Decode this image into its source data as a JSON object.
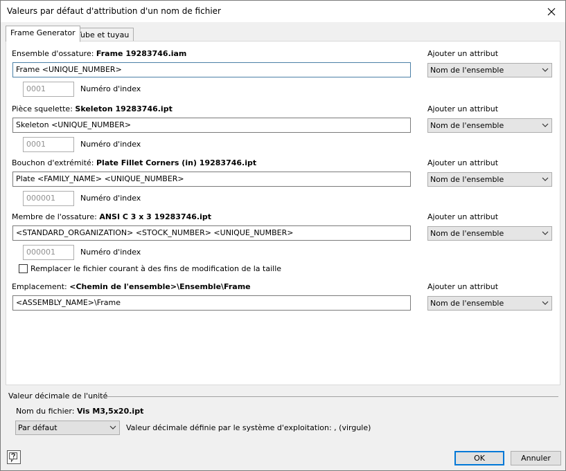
{
  "window": {
    "title": "Valeurs par défaut d'attribution d'un nom de fichier"
  },
  "tabs": [
    {
      "label": "Frame Generator"
    },
    {
      "label": "Tube et tuyau"
    }
  ],
  "sections": [
    {
      "label": "Ensemble d'ossature:",
      "name": "Frame 19283746.iam",
      "value": "Frame <UNIQUE_NUMBER>",
      "index_value": "0001",
      "index_label": "Numéro d'index",
      "attr_label": "Ajouter un attribut",
      "attr_value": "Nom de l'ensemble"
    },
    {
      "label": "Pièce squelette:",
      "name": "Skeleton 19283746.ipt",
      "value": "Skeleton <UNIQUE_NUMBER>",
      "index_value": "0001",
      "index_label": "Numéro d'index",
      "attr_label": "Ajouter un attribut",
      "attr_value": "Nom de l'ensemble"
    },
    {
      "label": "Bouchon d'extrémité:",
      "name": "Plate Fillet Corners (in) 19283746.ipt",
      "value": "Plate <FAMILY_NAME> <UNIQUE_NUMBER>",
      "index_value": "000001",
      "index_label": "Numéro d'index",
      "attr_label": "Ajouter un attribut",
      "attr_value": "Nom de l'ensemble"
    },
    {
      "label": "Membre de l'ossature:",
      "name": "ANSI C 3 x 3 19283746.ipt",
      "value": "<STANDARD_ORGANIZATION> <STOCK_NUMBER> <UNIQUE_NUMBER>",
      "index_value": "000001",
      "index_label": "Numéro d'index",
      "attr_label": "Ajouter un attribut",
      "attr_value": "Nom de l'ensemble"
    }
  ],
  "replace_checkbox": {
    "label": "Remplacer le fichier courant à des fins de modification de la taille"
  },
  "location": {
    "label": "Emplacement:",
    "name": "<Chemin de l'ensemble>\\Ensemble\\Frame",
    "value": "<ASSEMBLY_NAME>\\Frame",
    "attr_label": "Ajouter un attribut",
    "attr_value": "Nom de l'ensemble"
  },
  "unit": {
    "group_title": "Valeur décimale de l'unité",
    "file_label": "Nom du fichier:",
    "file_name": "Vis M3,5x20.ipt",
    "combo_value": "Par défaut",
    "system_text": "Valeur décimale définie par le système d'exploitation: , (virgule)"
  },
  "buttons": {
    "ok": "OK",
    "cancel": "Annuler"
  }
}
